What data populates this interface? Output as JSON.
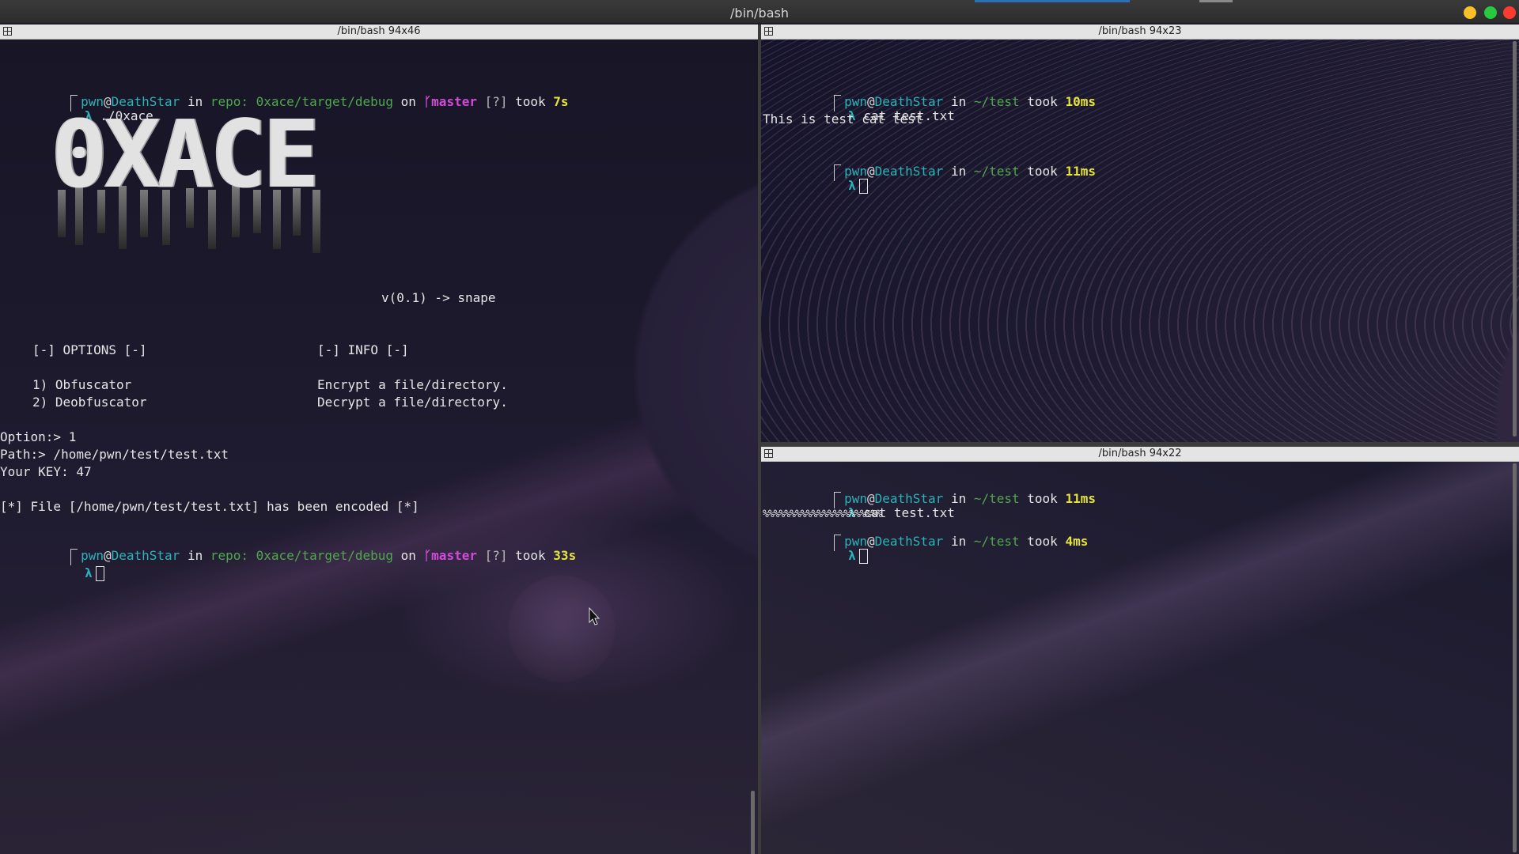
{
  "window": {
    "title": "/bin/bash",
    "colors": {
      "minimize": "#f6c026",
      "maximize": "#27c93f",
      "close": "#ff3b30"
    }
  },
  "panes": {
    "left": {
      "title": "/bin/bash 94x46",
      "prompt1": {
        "user": "pwn",
        "at": "@",
        "host": "DeathStar",
        "in": " in ",
        "dir": "repo: 0xace/target/debug",
        "on": " on ",
        "branch": "master",
        "status": " [?]",
        "took": " took ",
        "time": "7s"
      },
      "cmd1": " ./0xace",
      "logo_text": "0XACE",
      "version": "v(0.1) -> snape",
      "options_header": "[-] OPTIONS [-]",
      "info_header": "[-] INFO [-]",
      "option1": "1) Obfuscator",
      "option2": "2) Deobfuscator",
      "info1": "Encrypt a file/directory.",
      "info2": "Decrypt a file/directory.",
      "option_line": "Option:> 1",
      "path_line": "Path:> /home/pwn/test/test.txt",
      "key_line": "Your KEY: 47",
      "result_line": "[*] File [/home/pwn/test/test.txt] has been encoded [*]",
      "prompt2": {
        "user": "pwn",
        "at": "@",
        "host": "DeathStar",
        "in": " in ",
        "dir": "repo: 0xace/target/debug",
        "on": " on ",
        "branch": "master",
        "status": " [?]",
        "took": " took ",
        "time": "33s"
      }
    },
    "top_right": {
      "title": "/bin/bash 94x23",
      "prompt1": {
        "user": "pwn",
        "at": "@",
        "host": "DeathStar",
        "in": " in ",
        "dir": "~/test",
        "took": " took ",
        "time": "10ms"
      },
      "cmd1": " cat test.txt",
      "output1": "This is test cat test",
      "prompt2": {
        "user": "pwn",
        "at": "@",
        "host": "DeathStar",
        "in": " in ",
        "dir": "~/test",
        "took": " took ",
        "time": "11ms"
      }
    },
    "bottom_right": {
      "title": "/bin/bash 94x22",
      "prompt1": {
        "user": "pwn",
        "at": "@",
        "host": "DeathStar",
        "in": " in ",
        "dir": "~/test",
        "took": " took ",
        "time": "11ms"
      },
      "cmd1": " cat test.txt",
      "output1": "%%%%%%%%%%%%%%%%%%%%%%",
      "prompt2": {
        "user": "pwn",
        "at": "@",
        "host": "DeathStar",
        "in": " in ",
        "dir": "~/test",
        "took": " took ",
        "time": "4ms"
      }
    }
  },
  "lambda": "λ",
  "branch_icon": "branch-icon"
}
